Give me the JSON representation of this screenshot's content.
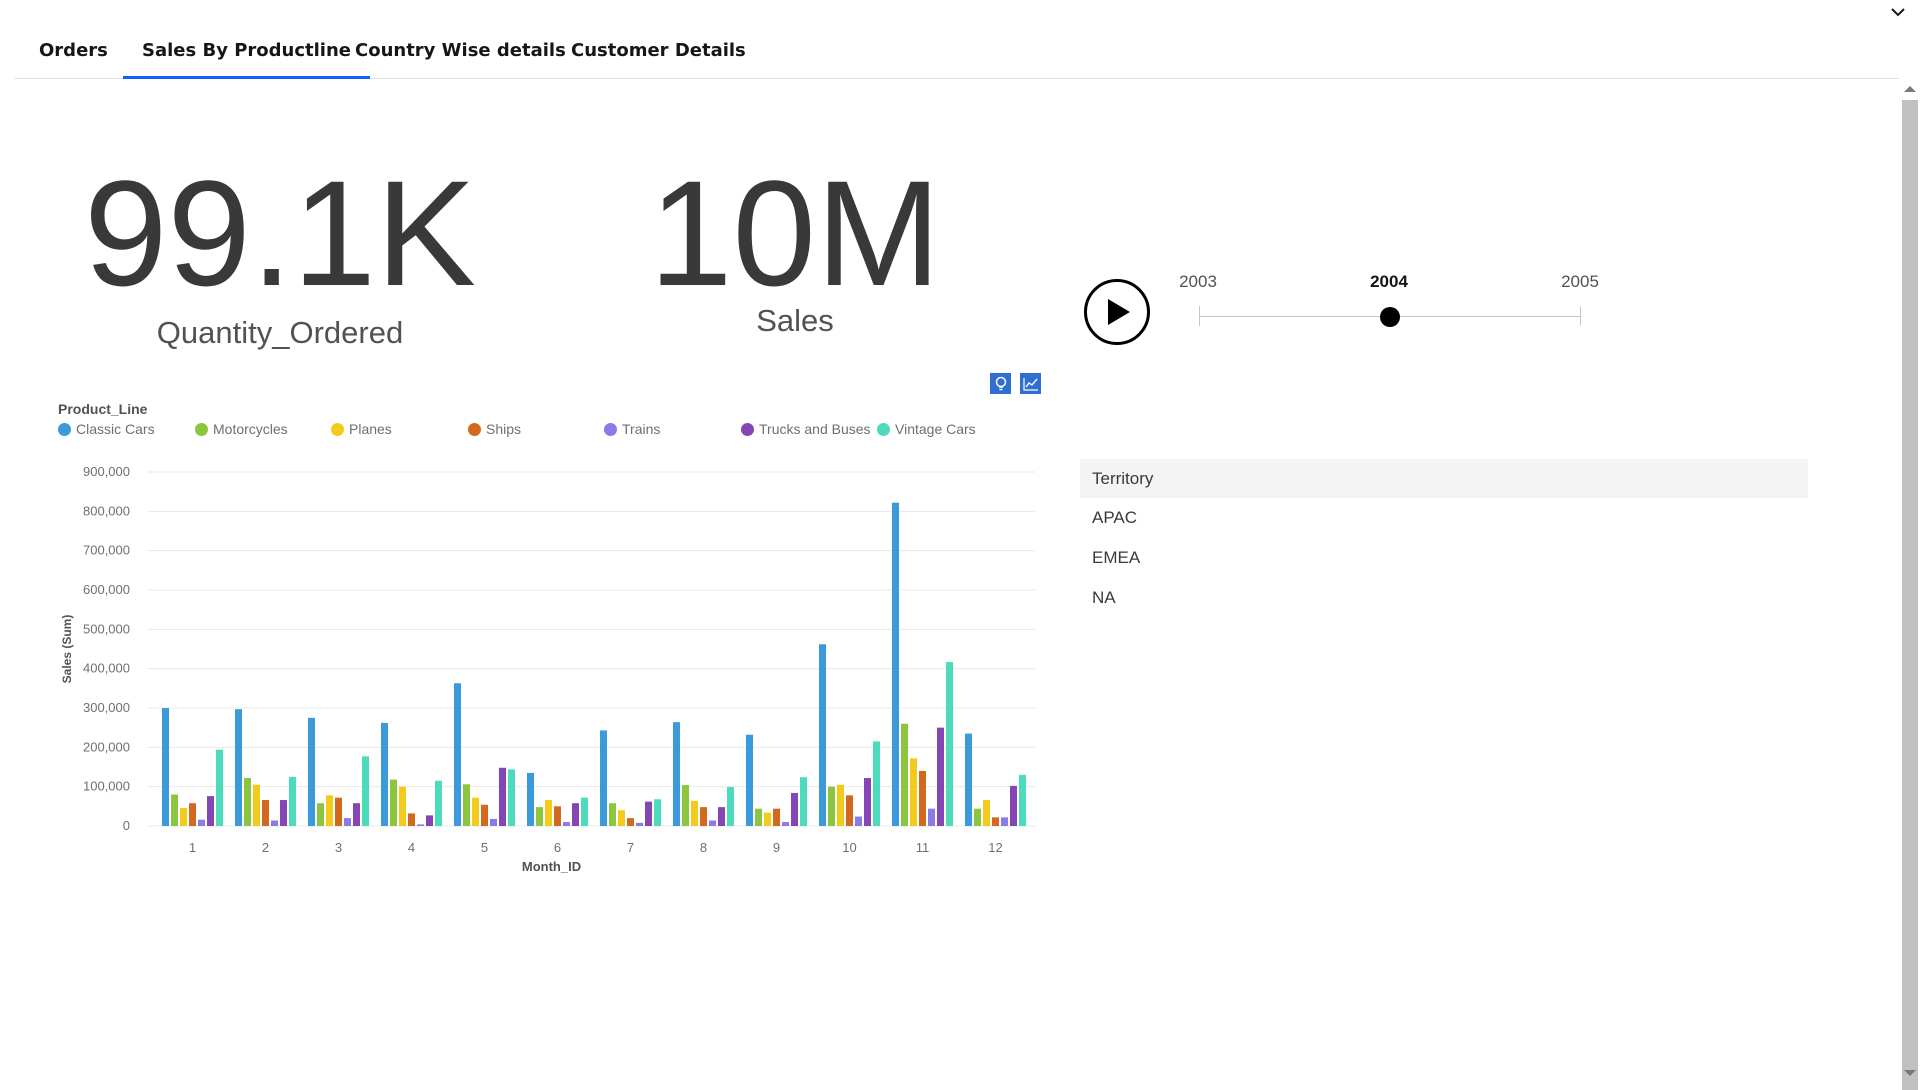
{
  "tabs": [
    {
      "label": "Orders",
      "active": false
    },
    {
      "label": "Sales By Productline",
      "active": true
    },
    {
      "label": "Country Wise details",
      "active": false
    },
    {
      "label": "Customer Details",
      "active": false
    }
  ],
  "kpis": {
    "quantity": {
      "value": "99.1K",
      "label": "Quantity_Ordered"
    },
    "sales": {
      "value": "10M",
      "label": "Sales"
    }
  },
  "timeline": {
    "years": [
      "2003",
      "2004",
      "2005"
    ],
    "selected": "2004",
    "play_icon": "play-icon"
  },
  "chart_tools": {
    "icons": [
      "lightbulb-icon",
      "line-chart-icon"
    ],
    "color": "#2f6fd1"
  },
  "territory": {
    "header": "Territory",
    "items": [
      "APAC",
      "EMEA",
      "NA"
    ]
  },
  "chart_data": {
    "type": "bar",
    "legend_title": "Product_Line",
    "legend_position": "top",
    "categories": [
      "1",
      "2",
      "3",
      "4",
      "5",
      "6",
      "7",
      "8",
      "9",
      "10",
      "11",
      "12"
    ],
    "xlabel": "Month_ID",
    "ylabel": "Sales (Sum)",
    "ylim": [
      0,
      900000
    ],
    "yticks": [
      0,
      100000,
      200000,
      300000,
      400000,
      500000,
      600000,
      700000,
      800000,
      900000
    ],
    "ytick_labels": [
      "0",
      "100,000",
      "200,000",
      "300,000",
      "400,000",
      "500,000",
      "600,000",
      "700,000",
      "800,000",
      "900,000"
    ],
    "grid": true,
    "series": [
      {
        "name": "Classic Cars",
        "color": "#3b9ad9",
        "values": [
          300000,
          297000,
          275000,
          262000,
          363000,
          135000,
          243000,
          264000,
          232000,
          462000,
          822000,
          235000
        ]
      },
      {
        "name": "Motorcycles",
        "color": "#8cc63e",
        "values": [
          80000,
          122000,
          58000,
          118000,
          106000,
          48000,
          58000,
          104000,
          44000,
          100000,
          260000,
          44000
        ]
      },
      {
        "name": "Planes",
        "color": "#f2cb1d",
        "values": [
          46000,
          105000,
          78000,
          100000,
          72000,
          66000,
          40000,
          64000,
          34000,
          105000,
          172000,
          66000
        ]
      },
      {
        "name": "Ships",
        "color": "#d2691e",
        "values": [
          58000,
          66000,
          72000,
          32000,
          54000,
          50000,
          20000,
          48000,
          44000,
          78000,
          140000,
          22000
        ]
      },
      {
        "name": "Trains",
        "color": "#8b7be6",
        "values": [
          16000,
          14000,
          20000,
          4000,
          18000,
          10000,
          8000,
          14000,
          10000,
          24000,
          44000,
          22000
        ]
      },
      {
        "name": "Trucks and Buses",
        "color": "#8446b5",
        "values": [
          76000,
          66000,
          58000,
          27000,
          148000,
          58000,
          62000,
          48000,
          84000,
          122000,
          250000,
          102000
        ]
      },
      {
        "name": "Vintage Cars",
        "color": "#4ddbbd",
        "values": [
          194000,
          125000,
          177000,
          115000,
          144000,
          72000,
          68000,
          99000,
          124000,
          215000,
          417000,
          130000
        ]
      }
    ]
  }
}
